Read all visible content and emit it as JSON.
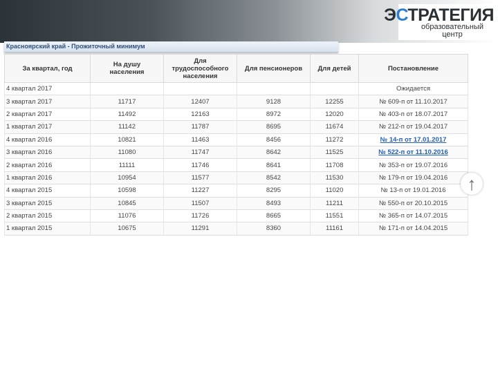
{
  "logo": {
    "main_prefix": "Э",
    "main_accent": "С",
    "main_rest": "ТРАТЕГИЯ",
    "sub_line1": "образовательный",
    "sub_line2": "центр"
  },
  "panel": {
    "title": "Красноярский край - Прожиточный минимум"
  },
  "table": {
    "headers": {
      "quarter": "За квартал, год",
      "per_capita_l1": "На душу",
      "per_capita_l2": "населения",
      "working_l1": "Для",
      "working_l2": "трудоспособного",
      "working_l3": "населения",
      "pensioners": "Для пенсионеров",
      "children": "Для детей",
      "decree": "Постановление"
    },
    "rows": [
      {
        "quarter": "4 квартал 2017",
        "per_capita": "",
        "working": "",
        "pensioners": "",
        "children": "",
        "decree": "Ожидается"
      },
      {
        "quarter": "3 квартал 2017",
        "per_capita": "11717",
        "working": "12407",
        "pensioners": "9128",
        "children": "12255",
        "decree": "№ 609-п от 11.10.2017"
      },
      {
        "quarter": "2 квартал 2017",
        "per_capita": "11492",
        "working": "12163",
        "pensioners": "8972",
        "children": "12020",
        "decree": "№ 403-п от 18.07.2017"
      },
      {
        "quarter": "1 квартал 2017",
        "per_capita": "11142",
        "working": "11787",
        "pensioners": "8695",
        "children": "11674",
        "decree": "№ 212-п от 19.04.2017"
      },
      {
        "quarter": "4 квартал 2016",
        "per_capita": "10821",
        "working": "11463",
        "pensioners": "8456",
        "children": "11272",
        "decree": "№ 14-п от 17.01.2017"
      },
      {
        "quarter": "3 квартал 2016",
        "per_capita": "11080",
        "working": "11747",
        "pensioners": "8642",
        "children": "11525",
        "decree": "№ 522-п от 11.10.2016"
      },
      {
        "quarter": "2 квартал 2016",
        "per_capita": "11111",
        "working": "11746",
        "pensioners": "8641",
        "children": "11708",
        "decree": "№ 353-п от 19.07.2016"
      },
      {
        "quarter": "1 квартал 2016",
        "per_capita": "10954",
        "working": "11577",
        "pensioners": "8542",
        "children": "11530",
        "decree": "№ 179-п от 19.04.2016"
      },
      {
        "quarter": "4 квартал 2015",
        "per_capita": "10598",
        "working": "11227",
        "pensioners": "8295",
        "children": "11020",
        "decree": "№ 13-п от 19.01.2016"
      },
      {
        "quarter": "3 квартал 2015",
        "per_capita": "10845",
        "working": "11507",
        "pensioners": "8493",
        "children": "11211",
        "decree": "№ 550-п от 20.10.2015"
      },
      {
        "quarter": "2 квартал 2015",
        "per_capita": "11076",
        "working": "11726",
        "pensioners": "8665",
        "children": "11551",
        "decree": "№ 365-п от 14.07.2015"
      },
      {
        "quarter": "1 квартал 2015",
        "per_capita": "10675",
        "working": "11291",
        "pensioners": "8360",
        "children": "11161",
        "decree": "№ 171-п от 14.04.2015"
      }
    ]
  },
  "scroll_top": {
    "glyph": "↑"
  }
}
